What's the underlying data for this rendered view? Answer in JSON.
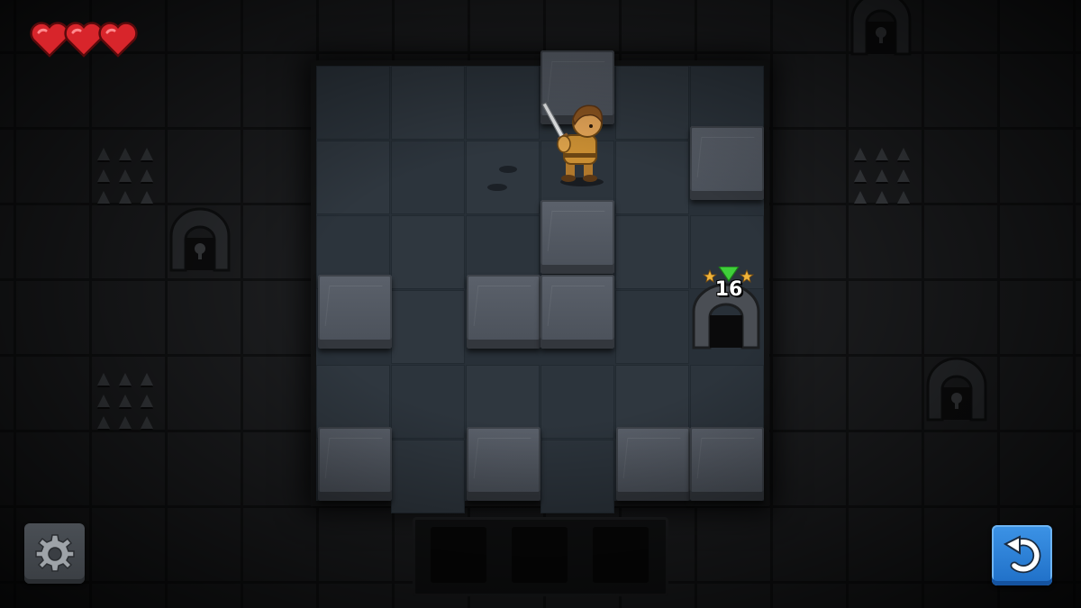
{
  "game": {
    "lives": 3,
    "hearts": [
      "heart",
      "heart",
      "heart"
    ],
    "exit": {
      "moves_remaining": "16",
      "stars": 2,
      "marker": "green-arrow"
    }
  },
  "buttons": {
    "settings_icon": "gear-icon",
    "undo_icon": "undo-icon"
  },
  "colors": {
    "heart": "#d8252b",
    "undo_button": "#2d7fd8",
    "exit_marker": "#3fcf3a",
    "star": "#f0b43a"
  }
}
